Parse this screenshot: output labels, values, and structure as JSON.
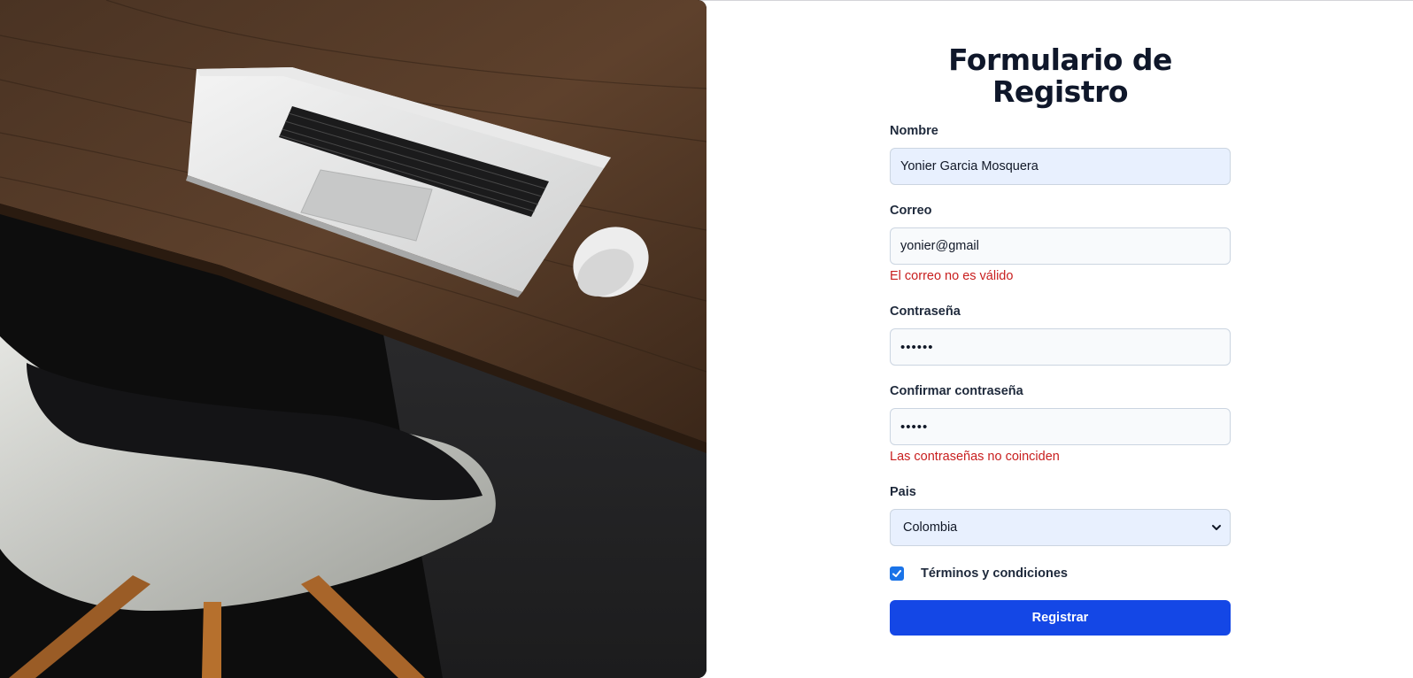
{
  "form": {
    "title_line1": "Formulario de",
    "title_line2": "Registro",
    "fields": {
      "name": {
        "label": "Nombre",
        "value": "Yonier Garcia Mosquera"
      },
      "email": {
        "label": "Correo",
        "value": "yonier@gmail",
        "error": "El correo no es válido"
      },
      "password": {
        "label": "Contraseña",
        "value": "••••••"
      },
      "confirm": {
        "label": "Confirmar contraseña",
        "value": "•••••",
        "error": "Las contraseñas no coinciden"
      },
      "country": {
        "label": "Pais",
        "selected": "Colombia"
      }
    },
    "terms": {
      "label": "Términos y condiciones",
      "checked": true
    },
    "submit_label": "Registrar"
  },
  "colors": {
    "accent": "#1447e6",
    "error": "#c81e1e",
    "checkbox": "#1a73e8",
    "autofill_bg": "#e8f0fe"
  },
  "icons": {
    "select": "chevron-down-icon",
    "checkbox": "checkmark-icon"
  }
}
